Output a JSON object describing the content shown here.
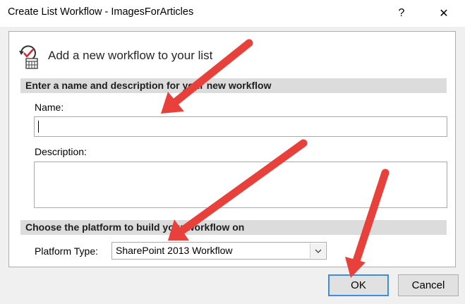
{
  "window": {
    "title": "Create List Workflow - ImagesForArticles",
    "help_label": "?",
    "close_label": "✕"
  },
  "header": {
    "icon": "workflow-icon",
    "text": "Add a new workflow to your list"
  },
  "section_name": {
    "title": "Enter a name and description for your new workflow",
    "name_label": "Name:",
    "name_value": "",
    "description_label": "Description:",
    "description_value": ""
  },
  "section_platform": {
    "title": "Choose the platform to build your workflow on",
    "platform_label": "Platform Type:",
    "platform_value": "SharePoint 2013 Workflow"
  },
  "buttons": {
    "ok": "OK",
    "cancel": "Cancel"
  },
  "colors": {
    "annotation_arrow": "#e8413b",
    "section_band": "#dcdcdc",
    "ok_focus_border": "#3c8ee0"
  }
}
